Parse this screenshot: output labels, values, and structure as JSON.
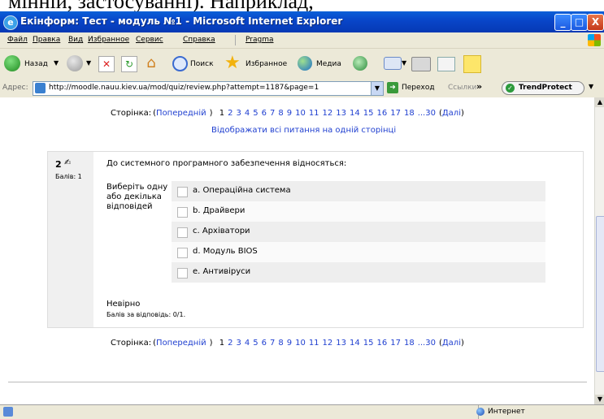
{
  "doc_text": "мінній, застосуванні). Наприклад,",
  "window": {
    "title": "Екінформ: Тест - модуль №1 - Microsoft Internet Explorer",
    "minimize": "_",
    "maximize": "□",
    "close": "X"
  },
  "menu": [
    "Файл",
    "Правка",
    "Вид",
    "Избранное",
    "Сервис",
    "Справка",
    "Pragma"
  ],
  "toolbar": {
    "back": "Назад",
    "search": "Поиск",
    "favorites": "Избранное",
    "media": "Медиа"
  },
  "address": {
    "label": "Адрес:",
    "url": "http://moodle.nauu.kiev.ua/mod/quiz/review.php?attempt=1187&page=1",
    "go": "Переход",
    "links": "Ссылки",
    "chevron": "»",
    "trend": "TrendProtect"
  },
  "pager": {
    "label": "Сторінка:",
    "prev": "Попередній",
    "current": "1",
    "pages": [
      "2",
      "3",
      "4",
      "5",
      "6",
      "7",
      "8",
      "9",
      "10",
      "11",
      "12",
      "13",
      "14",
      "15",
      "16",
      "17",
      "18",
      "...30"
    ],
    "next": "Далі",
    "open_paren": "(",
    "close_paren": ")"
  },
  "show_all": "Відображати всі питання на одній сторінці",
  "question": {
    "number": "2",
    "marks_label": "Балів: 1",
    "text": "До системного програмного забезпечення відносяться:",
    "prompt": "Виберіть одну або декілька відповідей",
    "options": [
      "a. Операційна система",
      "b. Драйвери",
      "c. Архіватори",
      "d. Модуль BIOS",
      "e. Антивіруси"
    ],
    "verdict": "Невірно",
    "score": "Балів за відповідь: 0/1."
  },
  "status": {
    "zone": "Интернет"
  }
}
